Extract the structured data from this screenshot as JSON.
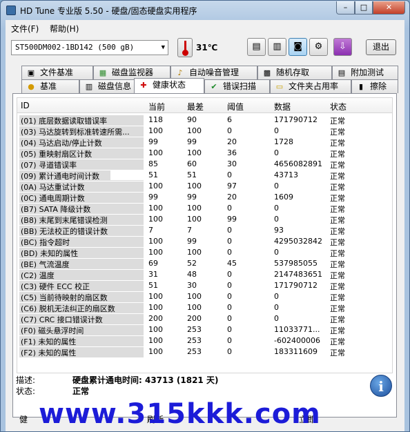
{
  "window": {
    "title": "HD Tune 专业版 5.50 - 硬盘/固态硬盘实用程序",
    "minimize": "–",
    "maximize": "□",
    "close": "✕"
  },
  "menu": [
    "文件(F)",
    "帮助(H)"
  ],
  "toolbar": {
    "drive": "ST500DM002-1BD142 (500 gB)",
    "temperature": "31℃",
    "buttons": [
      {
        "name": "copy-text-icon",
        "glyph": "▤"
      },
      {
        "name": "copy-screen-icon",
        "glyph": "▥"
      },
      {
        "name": "screenshot-camera-icon",
        "glyph": "◙"
      },
      {
        "name": "options-wrench-icon",
        "glyph": "⚙"
      },
      {
        "name": "save-download-icon",
        "glyph": "⇩"
      }
    ],
    "exit": "退出"
  },
  "tabs_row1": [
    {
      "label": "文件基准",
      "icon": "file-benchmark-icon",
      "glyph": "▣"
    },
    {
      "label": "磁盘监视器",
      "icon": "disk-monitor-icon",
      "glyph": "▦"
    },
    {
      "label": "自动噪音管理",
      "icon": "speaker-icon",
      "glyph": "♪"
    },
    {
      "label": "随机存取",
      "icon": "random-access-icon",
      "glyph": "▩"
    },
    {
      "label": "附加测试",
      "icon": "extra-tests-icon",
      "glyph": "▤"
    }
  ],
  "tabs_row2": [
    {
      "label": "基准",
      "icon": "benchmark-icon",
      "glyph": "●"
    },
    {
      "label": "磁盘信息",
      "icon": "disk-info-icon",
      "glyph": "▥"
    },
    {
      "label": "健康状态",
      "icon": "health-cross-icon",
      "glyph": "✚"
    },
    {
      "label": "错误扫描",
      "icon": "error-scan-icon",
      "glyph": "✔"
    },
    {
      "label": "文件夹占用率",
      "icon": "folder-icon",
      "glyph": "▭"
    },
    {
      "label": "擦除",
      "icon": "erase-trash-icon",
      "glyph": "▮"
    }
  ],
  "table": {
    "headers": [
      "ID",
      "当前",
      "最差",
      "阈值",
      "数据",
      "状态"
    ],
    "rows": [
      [
        "(01) 底层数据读取错误率",
        "118",
        "90",
        "6",
        "171790712",
        "正常"
      ],
      [
        "(03) 马达旋转到标准转速所需...",
        "100",
        "100",
        "0",
        "0",
        "正常"
      ],
      [
        "(04) 马达启动/停止计数",
        "99",
        "99",
        "20",
        "1728",
        "正常"
      ],
      [
        "(05) 重映射扇区计数",
        "100",
        "100",
        "36",
        "0",
        "正常"
      ],
      [
        "(07) 寻道错误率",
        "85",
        "60",
        "30",
        "4656082891",
        "正常"
      ],
      [
        "(09) 累计通电时间计数",
        "51",
        "51",
        "0",
        "43713",
        "正常"
      ],
      [
        "(0A) 马达重试计数",
        "100",
        "100",
        "97",
        "0",
        "正常"
      ],
      [
        "(0C) 通电周期计数",
        "99",
        "99",
        "20",
        "1609",
        "正常"
      ],
      [
        "(B7) SATA 降级计数",
        "100",
        "100",
        "0",
        "0",
        "正常"
      ],
      [
        "(B8) 末尾到末尾错误检测",
        "100",
        "100",
        "99",
        "0",
        "正常"
      ],
      [
        "(BB) 无法校正的错误计数",
        "7",
        "7",
        "0",
        "93",
        "正常"
      ],
      [
        "(BC) 指令超时",
        "100",
        "99",
        "0",
        "4295032842",
        "正常"
      ],
      [
        "(BD) 未知的属性",
        "100",
        "100",
        "0",
        "0",
        "正常"
      ],
      [
        "(BE) 气流温度",
        "69",
        "52",
        "45",
        "537985055",
        "正常"
      ],
      [
        "(C2) 温度",
        "31",
        "48",
        "0",
        "21474836511",
        "正常"
      ],
      [
        "(C3) 硬件 ECC 校正",
        "51",
        "30",
        "0",
        "171790712",
        "正常"
      ],
      [
        "(C5) 当前待映射的扇区数",
        "100",
        "100",
        "0",
        "0",
        "正常"
      ],
      [
        "(C6) 脱机无法纠正的扇区数",
        "100",
        "100",
        "0",
        "0",
        "正常"
      ],
      [
        "(C7) CRC 接口错误计数",
        "200",
        "200",
        "0",
        "0",
        "正常"
      ],
      [
        "(F0) 磁头悬浮时间",
        "100",
        "253",
        "0",
        "11033771...",
        "正常"
      ],
      [
        "(F1) 未知的属性",
        "100",
        "253",
        "0",
        "-602400006",
        "正常"
      ],
      [
        "(F2) 未知的属性",
        "100",
        "253",
        "0",
        "183311609",
        "正常"
      ]
    ]
  },
  "details": {
    "desc_label": "描述:",
    "desc_value": "硬盘累计通电时间: 43713 (1821 天)",
    "status_label": "状态:",
    "status_value": "正常"
  },
  "bottom": {
    "left_fragment": "健",
    "refresh_fragment": "刷新",
    "now_fragment": "立即"
  },
  "watermark": "www.315kkk.com"
}
